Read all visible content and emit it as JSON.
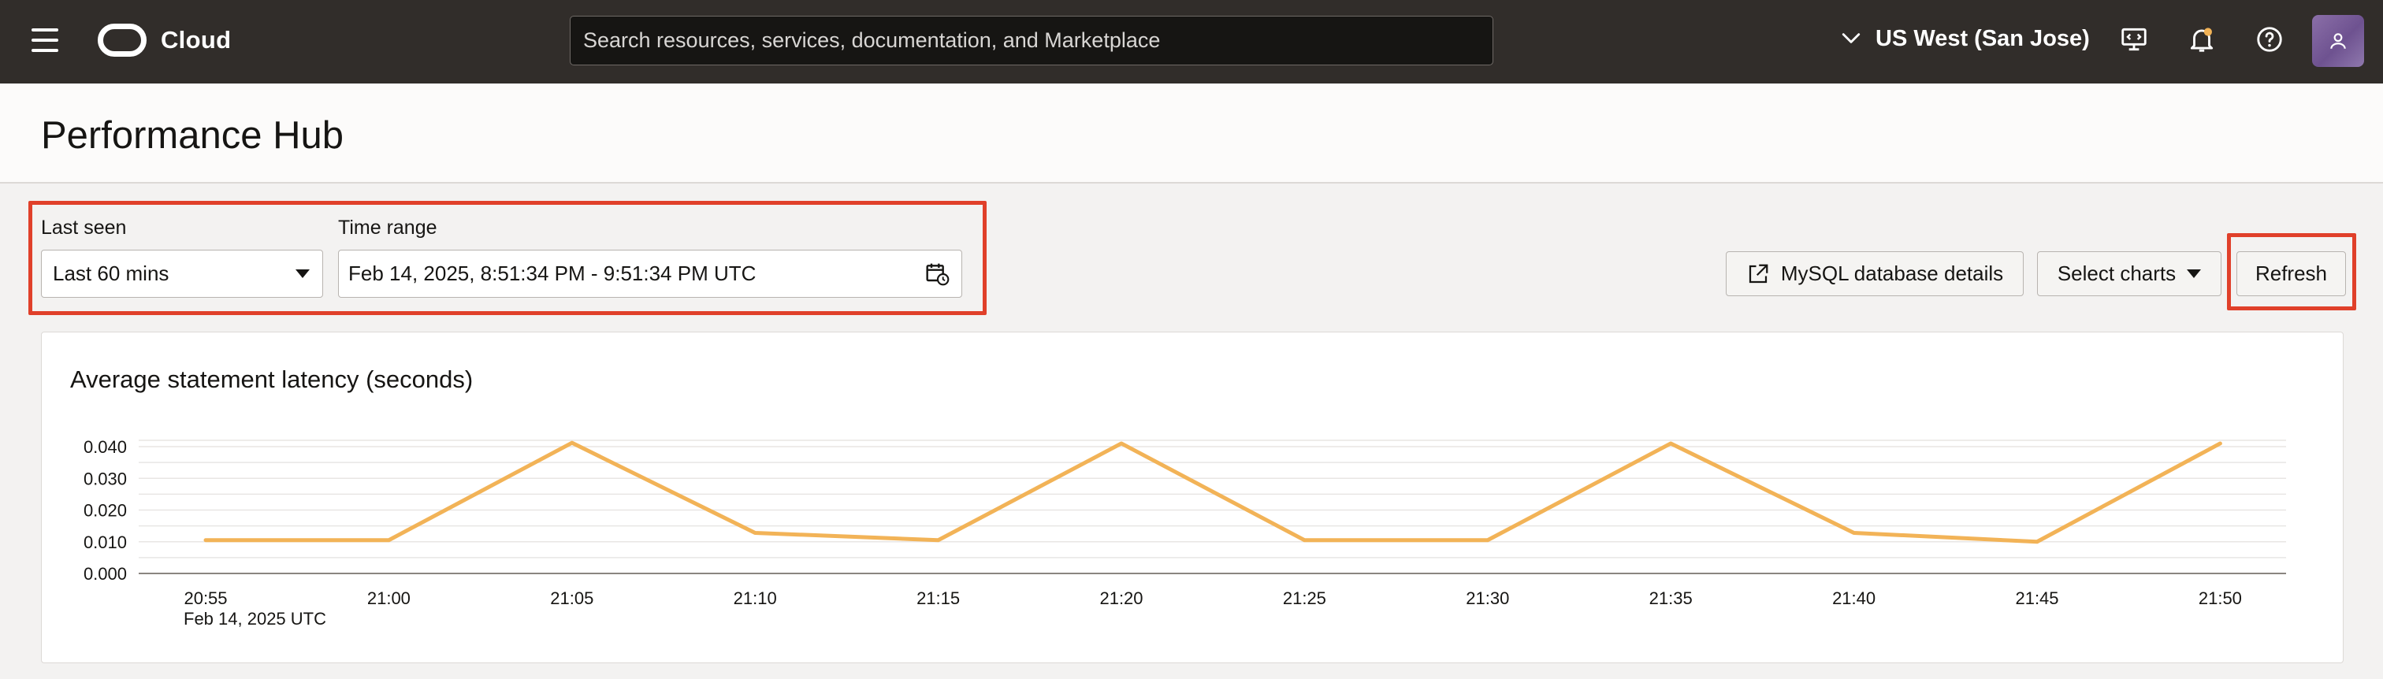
{
  "header": {
    "brand": "Cloud",
    "search_placeholder": "Search resources, services, documentation, and Marketplace",
    "region": "US West (San Jose)",
    "icons": [
      "menu-icon",
      "oracle-logo-icon",
      "chevron-down-icon",
      "developer-tools-icon",
      "bell-icon",
      "help-icon",
      "user-icon"
    ]
  },
  "page": {
    "title": "Performance Hub"
  },
  "filters": {
    "last_seen_label": "Last seen",
    "last_seen_value": "Last 60 mins",
    "time_range_label": "Time range",
    "time_range_value": "Feb 14, 2025, 8:51:34 PM - 9:51:34 PM UTC"
  },
  "actions": {
    "mysql_details": "MySQL database details",
    "select_charts": "Select charts",
    "refresh": "Refresh"
  },
  "colors": {
    "highlight": "#e0402a",
    "series": "#f2b357",
    "topbar": "#312d2a"
  },
  "chart_data": {
    "type": "line",
    "title": "Average statement latency (seconds)",
    "x": [
      "20:55",
      "21:00",
      "21:05",
      "21:10",
      "21:15",
      "21:20",
      "21:25",
      "21:30",
      "21:35",
      "21:40",
      "21:45",
      "21:50"
    ],
    "x_sublabel": "Feb 14, 2025 UTC",
    "y_ticks": [
      "0.000",
      "0.010",
      "0.020",
      "0.030",
      "0.040"
    ],
    "ylim": [
      0,
      0.04
    ],
    "grid": true,
    "series": [
      {
        "values": [
          0.0105,
          0.0105,
          0.0412,
          0.0128,
          0.0105,
          0.041,
          0.0105,
          0.0105,
          0.041,
          0.0128,
          0.01,
          0.041
        ]
      }
    ]
  }
}
